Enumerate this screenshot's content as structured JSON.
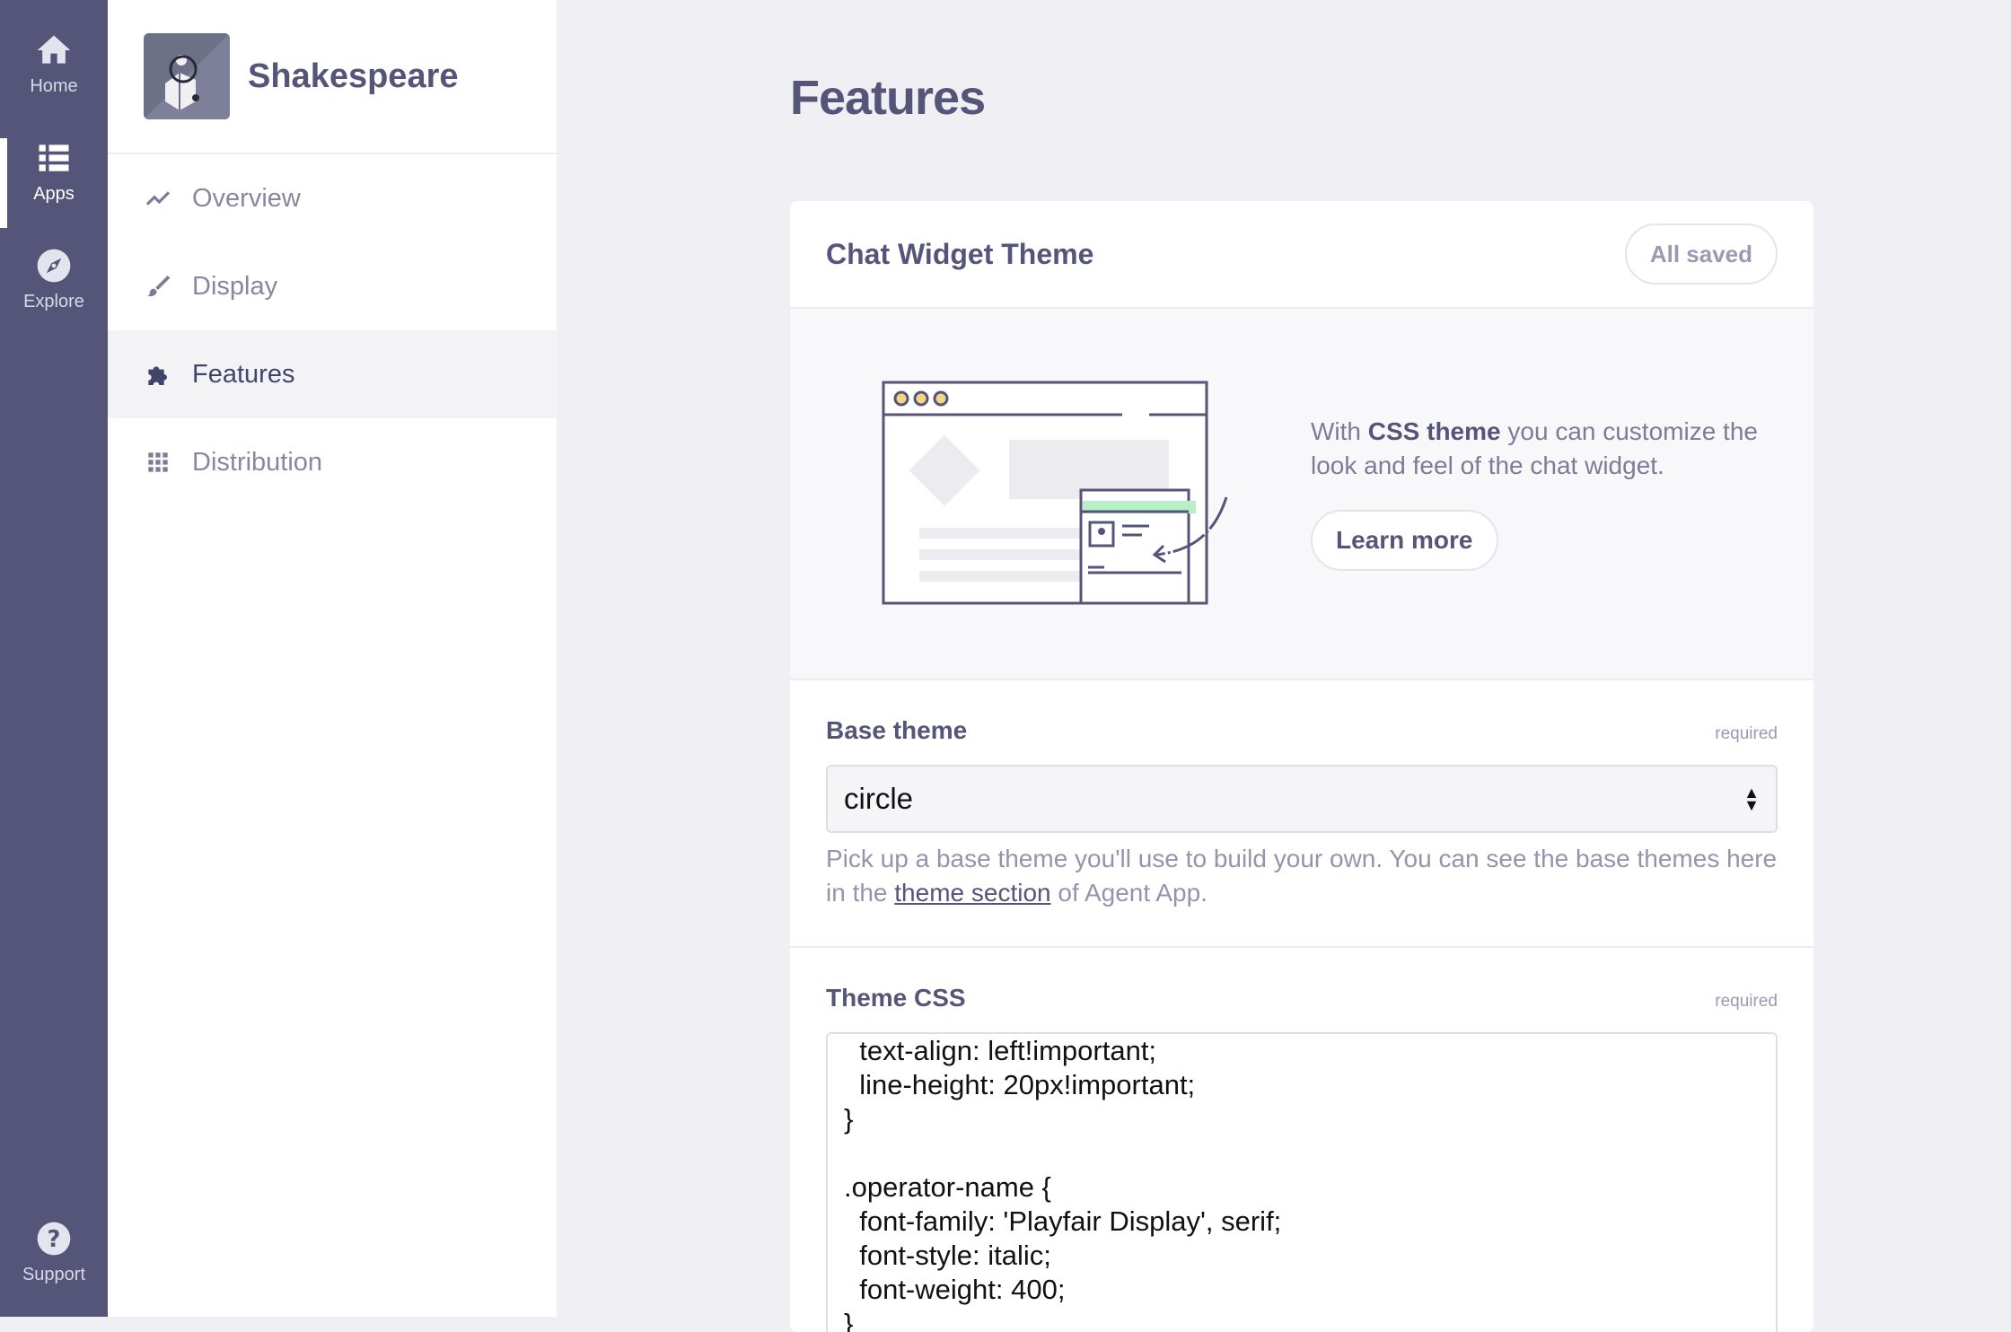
{
  "rail": {
    "items": [
      {
        "label": "Home",
        "icon": "home-icon"
      },
      {
        "label": "Apps",
        "icon": "apps-icon"
      },
      {
        "label": "Explore",
        "icon": "compass-icon"
      }
    ],
    "support": {
      "label": "Support",
      "icon": "help-icon"
    }
  },
  "sidebar": {
    "app_name": "Shakespeare",
    "nav": [
      {
        "label": "Overview",
        "icon": "trend-line-icon"
      },
      {
        "label": "Display",
        "icon": "brush-icon"
      },
      {
        "label": "Features",
        "icon": "puzzle-icon"
      },
      {
        "label": "Distribution",
        "icon": "grid-icon"
      }
    ],
    "active": "Features"
  },
  "page": {
    "title": "Features"
  },
  "card": {
    "title": "Chat Widget Theme",
    "status": "All saved",
    "promo": {
      "text_prefix": "With ",
      "text_bold": "CSS theme",
      "text_suffix": " you can customize the look and feel of the chat widget.",
      "button": "Learn more"
    },
    "base_theme": {
      "label": "Base theme",
      "required": "required",
      "value": "circle",
      "help_prefix": "Pick up a base theme you'll use to build your own. You can see the base themes here in the ",
      "help_link": "theme section",
      "help_suffix": " of Agent App."
    },
    "theme_css": {
      "label": "Theme CSS",
      "required": "required",
      "lines": [
        "  text-align: left!important;",
        "  line-height: 20px!important;",
        "}",
        "",
        ".operator-name {",
        "  font-family: 'Playfair Display', serif;",
        "  font-style: italic;",
        "  font-weight: 400;",
        "}"
      ]
    }
  },
  "colors": {
    "rail": "#55557a",
    "accent": "#55557a",
    "background": "#f0f0f4"
  }
}
